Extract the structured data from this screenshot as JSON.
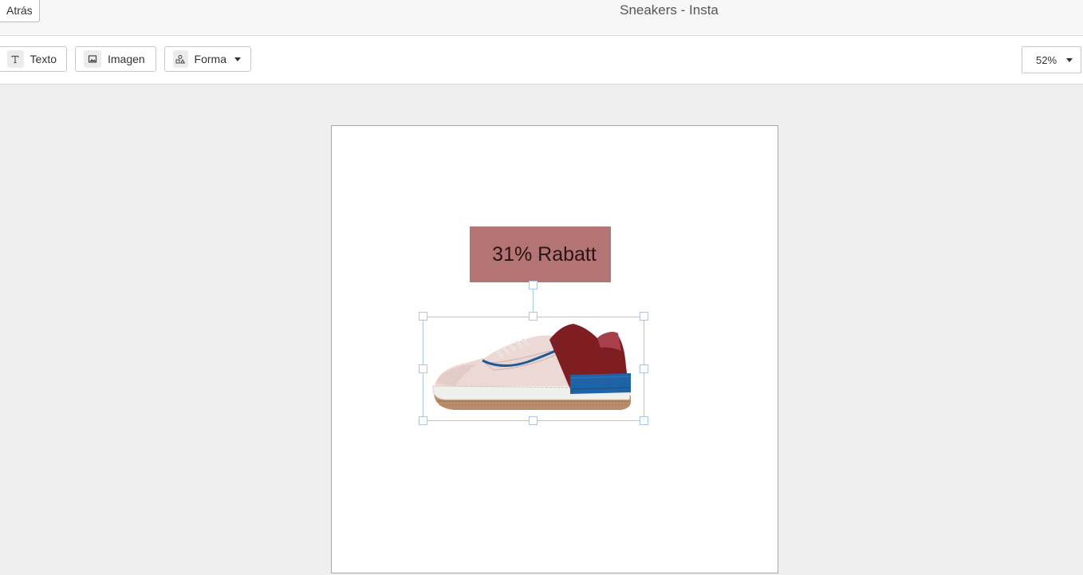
{
  "header": {
    "back_label": "Atrás",
    "title": "Sneakers - Insta"
  },
  "toolbar": {
    "text_label": "Texto",
    "image_label": "Imagen",
    "shape_label": "Forma",
    "zoom_value": "52%"
  },
  "canvas": {
    "price_tag_text": "31% Rabatt",
    "price_tag_color": "#b57474",
    "selection_color": "#a9c7ee"
  }
}
